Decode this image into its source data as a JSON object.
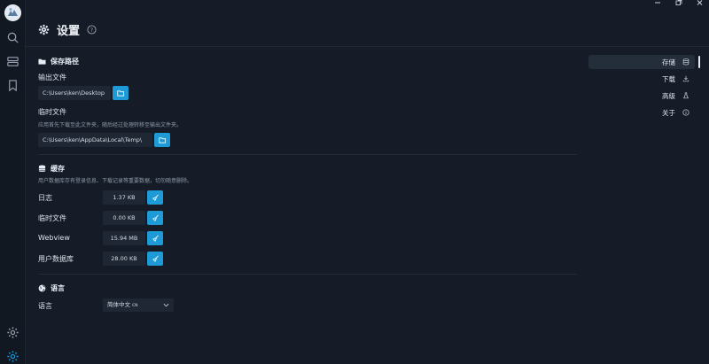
{
  "page": {
    "title": "设置"
  },
  "sections": {
    "storage_path": {
      "title": "保存路径",
      "output": {
        "label": "输出文件",
        "path": "C:\\Users\\ken\\Desktop"
      },
      "temp": {
        "label": "临时文件",
        "hint": "应用首先下载至此文件夹，随后经过处理转移至输出文件夹。",
        "path": "C:\\Users\\ken\\AppData\\Local\\Temp\\"
      }
    },
    "cache": {
      "title": "缓存",
      "hint": "用户数据库存有登录信息、下载记录等重要数据，切勿随意删除。",
      "rows": [
        {
          "label": "日志",
          "size": "1.37 KB"
        },
        {
          "label": "临时文件",
          "size": "0.00 KB"
        },
        {
          "label": "Webview",
          "size": "15.94 MB"
        },
        {
          "label": "用户数据库",
          "size": "28.00 KB"
        }
      ]
    },
    "language": {
      "title": "语言",
      "label": "语言",
      "selected": "简体中文",
      "selected_code": "CN"
    }
  },
  "nav": {
    "items": [
      {
        "label": "存储",
        "icon": "database-icon",
        "active": true
      },
      {
        "label": "下载",
        "icon": "download-icon",
        "active": false
      },
      {
        "label": "高级",
        "icon": "flask-icon",
        "active": false
      },
      {
        "label": "关于",
        "icon": "info-icon",
        "active": false
      }
    ]
  },
  "colors": {
    "background": "#151c28",
    "accent": "#1e9bd7",
    "field": "#1f2734"
  }
}
